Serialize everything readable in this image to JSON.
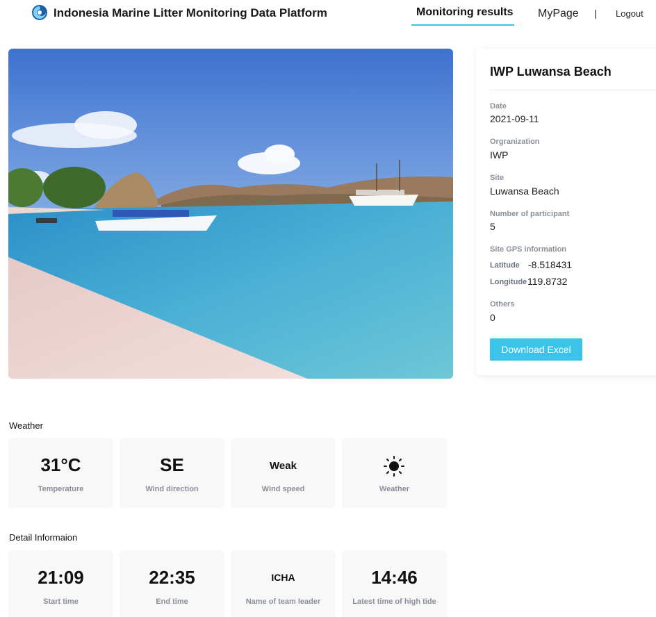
{
  "header": {
    "title": "Indonesia Marine Litter Monitoring Data Platform",
    "nav": {
      "monitoring": "Monitoring results",
      "mypage": "MyPage",
      "separator": "|",
      "logout": "Logout"
    }
  },
  "info": {
    "title": "IWP Luwansa Beach",
    "date_label": "Date",
    "date": "2021-09-11",
    "org_label": "Orgranization",
    "org": "IWP",
    "site_label": "Site",
    "site": "Luwansa Beach",
    "participants_label": "Number of participant",
    "participants": "5",
    "gps_label": "Site GPS information",
    "lat_label": "Latitude",
    "lat": "-8.518431",
    "lon_label": "Longitude",
    "lon": "119.8732",
    "others_label": "Others",
    "others": "0",
    "download": "Download Excel"
  },
  "weather": {
    "title": "Weather",
    "cards": [
      {
        "value": "31°C",
        "label": "Temperature"
      },
      {
        "value": "SE",
        "label": "Wind direction"
      },
      {
        "value": "Weak",
        "label": "Wind speed"
      },
      {
        "icon": "sun-icon",
        "label": "Weather"
      }
    ]
  },
  "detail": {
    "title": "Detail Informaion",
    "cards": [
      {
        "value": "21:09",
        "label": "Start time"
      },
      {
        "value": "22:35",
        "label": "End time"
      },
      {
        "value": "ICHA",
        "label": "Name of team leader"
      },
      {
        "value": "14:46",
        "label": "Latest time of high tide"
      }
    ]
  },
  "colors": {
    "accent": "#3bc4ea",
    "card_bg": "#f8f8f9",
    "label": "#8a8f99"
  }
}
